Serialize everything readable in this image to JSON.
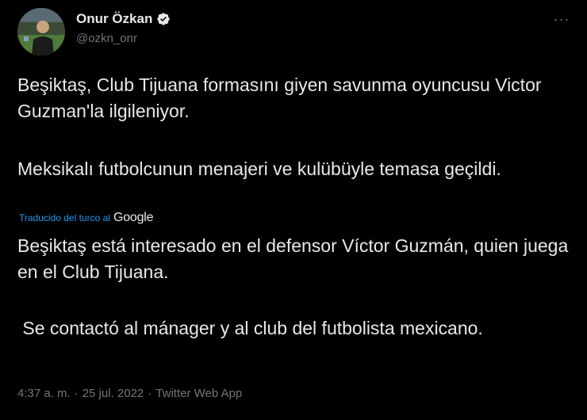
{
  "author": {
    "display_name": "Onur Özkan",
    "handle": "@ozkn_onr",
    "verified": true
  },
  "icons": {
    "verified": "verified-badge-icon",
    "more": "more-options-icon",
    "avatar": "profile-avatar"
  },
  "more_label": "···",
  "tweet": {
    "original_paragraphs": [
      "Beşiktaş, Club Tijuana formasını giyen savunma oyuncusu Victor Guzman'la ilgileniyor.",
      "Meksikalı futbolcunun menajeri ve kulübüyle temasa geçildi."
    ],
    "translation_credit": "Traducido del turco al",
    "translation_provider": "Google",
    "translated_paragraphs": [
      "Beşiktaş está interesado en el defensor Víctor Guzmán, quien juega en el Club Tijuana.",
      " Se contactó al mánager y al club del futbolista mexicano."
    ]
  },
  "meta": {
    "time": "4:37 a. m.",
    "separator": "·",
    "date": "25 jul. 2022",
    "source": "Twitter Web App"
  },
  "colors": {
    "background": "#000000",
    "text": "#e7e9ea",
    "secondary": "#71767b",
    "link": "#1d9bf0"
  }
}
